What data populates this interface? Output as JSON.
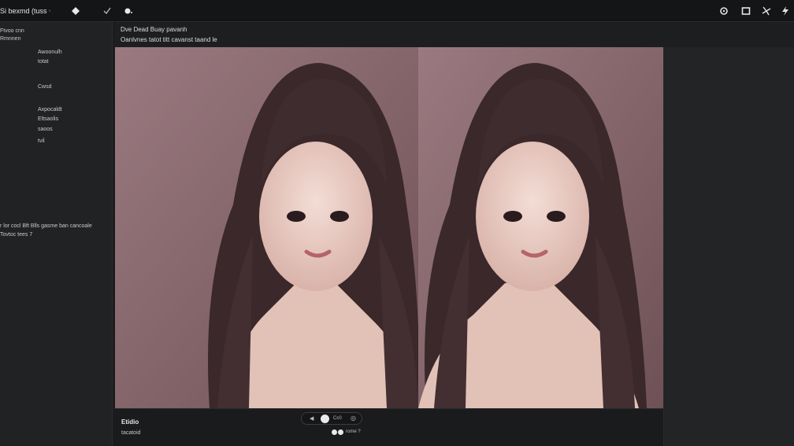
{
  "app": {
    "title": "Si bexmd (tuss",
    "title_suffix": "°"
  },
  "toolbar": {
    "left_icons": [
      "diamond-icon",
      "checkmark-icon",
      "brush-icon"
    ],
    "right_icons": [
      "settings-gear-icon",
      "window-icon",
      "pinwheel-icon",
      "lightning-icon"
    ]
  },
  "sidebar": {
    "header": [
      "Ftvoo cnn",
      "Rmnnen"
    ],
    "items": [
      {
        "label": "Awoonulh"
      },
      {
        "label": "totat"
      },
      {
        "label": "Cwsd"
      },
      {
        "label": "Axpocaldt"
      },
      {
        "label": "Eltsaolis"
      },
      {
        "label": "saoos"
      },
      {
        "label": "tvil"
      }
    ],
    "note_line1": "r lor cocl Bft Blls gasme ban cancoale",
    "note_line2": "Tovtoc tees 7"
  },
  "content": {
    "header_line1": "Dve Dead Buay pavanh",
    "header_line2": "Oanlvnes tatot titt cavanst taand le"
  },
  "bottombar": {
    "title": "Etidio",
    "subtitle": "tacatoid",
    "player_prev": "◀",
    "player_time": "Cc0",
    "player_next": "◎",
    "control_label": "rome",
    "control_suffix": "?"
  },
  "colors": {
    "background": "#1b1c1d",
    "panel": "#202224",
    "image_bg": "#8a6c72",
    "hair": "#3b2a2c",
    "skin": "#e9cdc4"
  }
}
